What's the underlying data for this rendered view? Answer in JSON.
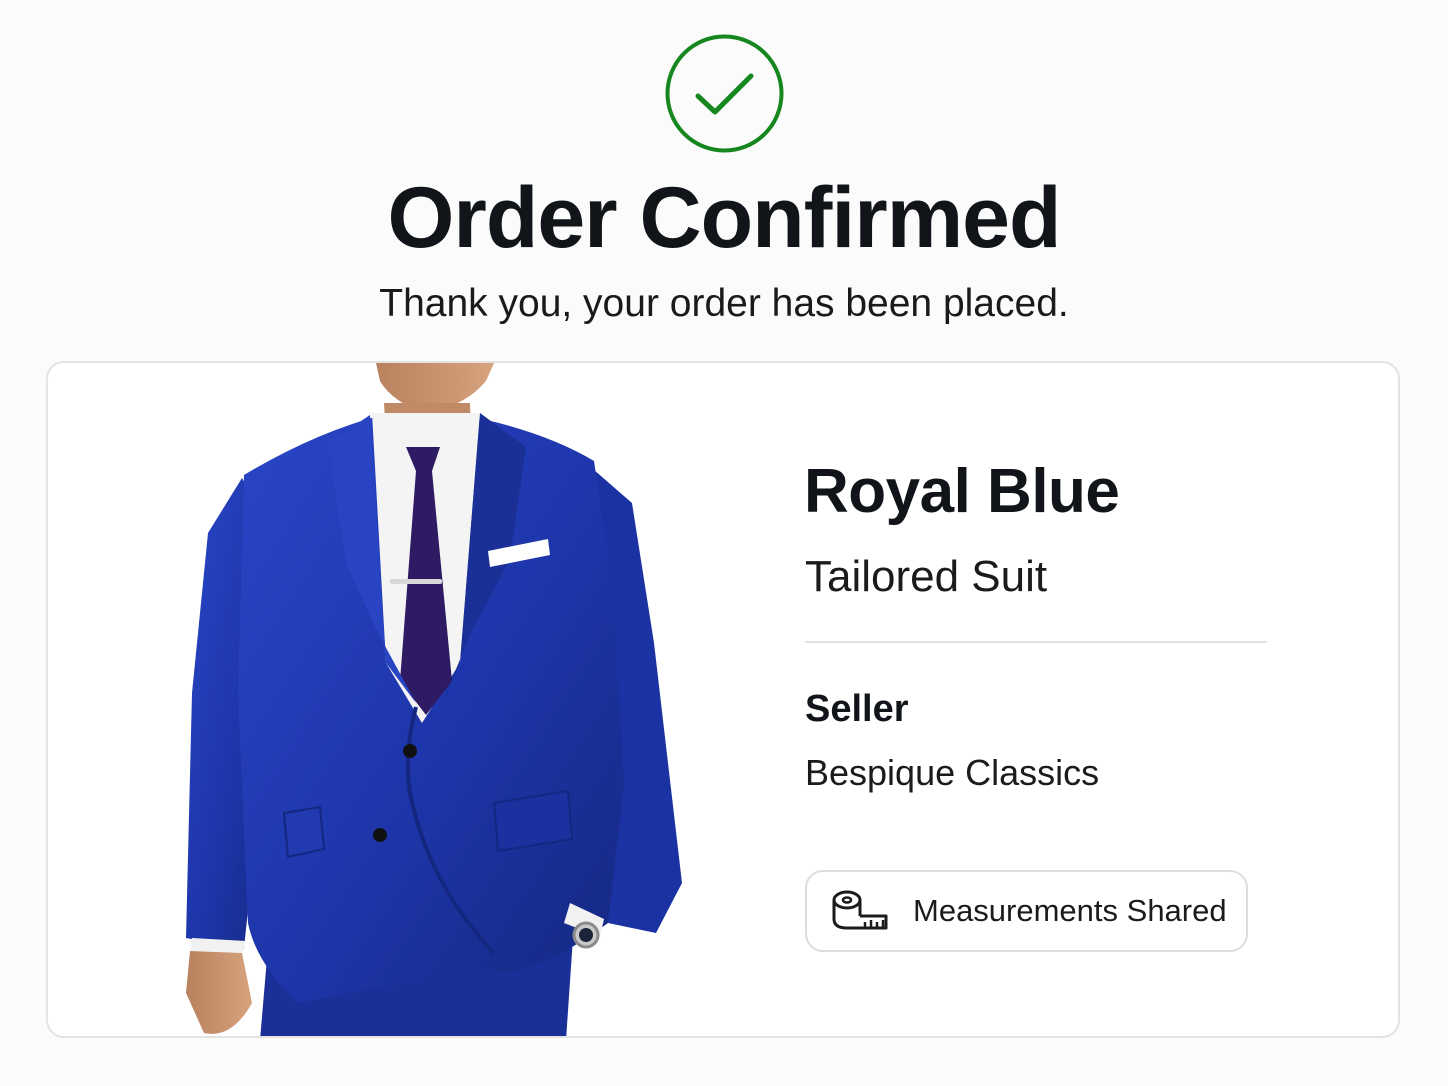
{
  "header": {
    "icon": "check-circle-icon",
    "title": "Order Confirmed",
    "subtitle": "Thank you, your order has been placed."
  },
  "product": {
    "image_icon": "royal-blue-suit-photo",
    "name": "Royal Blue",
    "type": "Tailored Suit",
    "seller_label": "Seller",
    "seller_name": "Bespique Classics",
    "badge": {
      "icon": "measuring-tape-icon",
      "label": "Measurements Shared"
    }
  },
  "colors": {
    "success": "#16871f",
    "suit_blue": "#1f37a8",
    "tie": "#2f1a64",
    "text": "#111419",
    "border": "#e3e3e3"
  }
}
